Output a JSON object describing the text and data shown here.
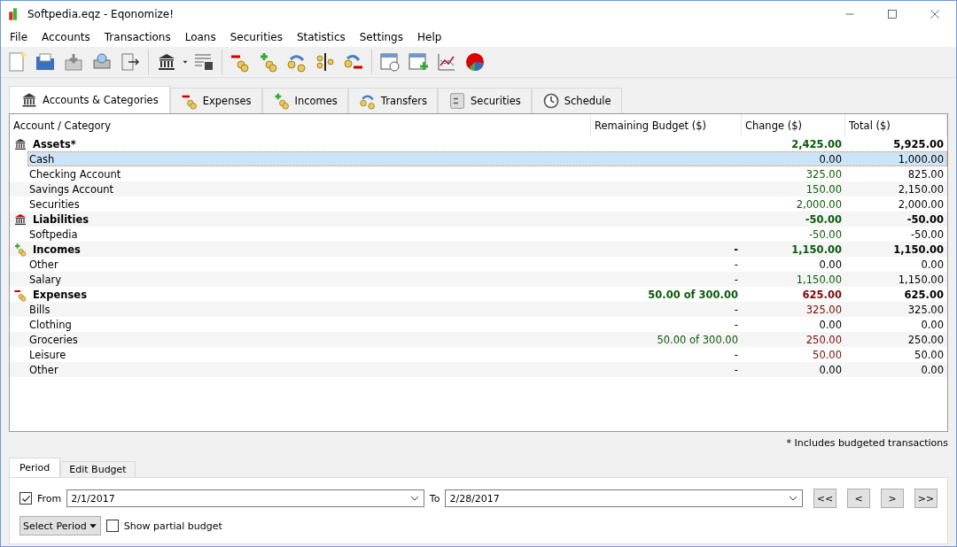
{
  "window": {
    "title": "Softpedia.eqz - Eqonomize!"
  },
  "menu": [
    "File",
    "Accounts",
    "Transactions",
    "Loans",
    "Securities",
    "Statistics",
    "Settings",
    "Help"
  ],
  "tabs": [
    {
      "label": "Accounts & Categories",
      "selected": true
    },
    {
      "label": "Expenses",
      "selected": false
    },
    {
      "label": "Incomes",
      "selected": false
    },
    {
      "label": "Transfers",
      "selected": false
    },
    {
      "label": "Securities",
      "selected": false
    },
    {
      "label": "Schedule",
      "selected": false
    }
  ],
  "table": {
    "columns": [
      "Account / Category",
      "Remaining Budget ($)",
      "Change ($)",
      "Total ($)"
    ],
    "rows": [
      {
        "kind": "assets",
        "name": "Assets*",
        "change": {
          "text": "2,425.00",
          "color": "#0a5a0a"
        },
        "total": "5,925.00",
        "selected": false
      },
      {
        "kind": "item",
        "name": "Cash",
        "change": {
          "text": "0.00"
        },
        "total": "1,000.00",
        "selected": true
      },
      {
        "kind": "item",
        "name": "Checking Account",
        "change": {
          "text": "325.00",
          "color": "#0a5a0a"
        },
        "total": "825.00",
        "selected": false
      },
      {
        "kind": "item",
        "name": "Savings Account",
        "change": {
          "text": "150.00",
          "color": "#0a5a0a"
        },
        "total": "2,150.00",
        "selected": false
      },
      {
        "kind": "item",
        "name": "Securities",
        "change": {
          "text": "2,000.00",
          "color": "#0a5a0a"
        },
        "total": "2,000.00",
        "selected": false
      },
      {
        "kind": "liabilities",
        "name": "Liabilities",
        "change": {
          "text": "-50.00",
          "color": "#0a5a0a"
        },
        "total": "-50.00",
        "selected": false
      },
      {
        "kind": "item",
        "name": "Softpedia",
        "change": {
          "text": "-50.00",
          "color": "#0a5a0a"
        },
        "total": "-50.00",
        "selected": false
      },
      {
        "kind": "incomes",
        "name": "Incomes",
        "budget": {
          "text": "-"
        },
        "change": {
          "text": "1,150.00",
          "color": "#0a5a0a"
        },
        "total": "1,150.00",
        "selected": false
      },
      {
        "kind": "item",
        "name": "Other",
        "budget": {
          "text": "-"
        },
        "change": {
          "text": "0.00"
        },
        "total": "0.00",
        "selected": false
      },
      {
        "kind": "item",
        "name": "Salary",
        "budget": {
          "text": "-"
        },
        "change": {
          "text": "1,150.00",
          "color": "#0a5a0a"
        },
        "total": "1,150.00",
        "selected": false
      },
      {
        "kind": "expenses",
        "name": "Expenses",
        "budget": {
          "text": "50.00 of 300.00",
          "color": "#0a5a0a"
        },
        "change": {
          "text": "625.00",
          "color": "#7a0a0a"
        },
        "total": "625.00",
        "selected": false
      },
      {
        "kind": "item",
        "name": "Bills",
        "budget": {
          "text": "-"
        },
        "change": {
          "text": "325.00",
          "color": "#7a0a0a"
        },
        "total": "325.00",
        "selected": false
      },
      {
        "kind": "item",
        "name": "Clothing",
        "budget": {
          "text": "-"
        },
        "change": {
          "text": "0.00"
        },
        "total": "0.00",
        "selected": false
      },
      {
        "kind": "item",
        "name": "Groceries",
        "budget": {
          "text": "50.00 of 300.00",
          "color": "#0a5a0a"
        },
        "change": {
          "text": "250.00",
          "color": "#7a0a0a"
        },
        "total": "250.00",
        "selected": false
      },
      {
        "kind": "item",
        "name": "Leisure",
        "budget": {
          "text": "-"
        },
        "change": {
          "text": "50.00",
          "color": "#7a0a0a"
        },
        "total": "50.00",
        "selected": false
      },
      {
        "kind": "item",
        "name": "Other",
        "budget": {
          "text": "-"
        },
        "change": {
          "text": "0.00"
        },
        "total": "0.00",
        "selected": false
      }
    ]
  },
  "footnote": "* Includes budgeted transactions",
  "bottom_tabs": [
    {
      "label": "Period",
      "selected": true
    },
    {
      "label": "Edit Budget",
      "selected": false
    }
  ],
  "period": {
    "from_checked": true,
    "from_label": "From",
    "from_value": "2/1/2017",
    "to_label": "To",
    "to_value": "2/28/2017",
    "nav_buttons": [
      "<<",
      "<",
      ">",
      ">>"
    ],
    "select_period": "Select Period",
    "partial_label": "Show partial budget",
    "partial_checked": false
  }
}
